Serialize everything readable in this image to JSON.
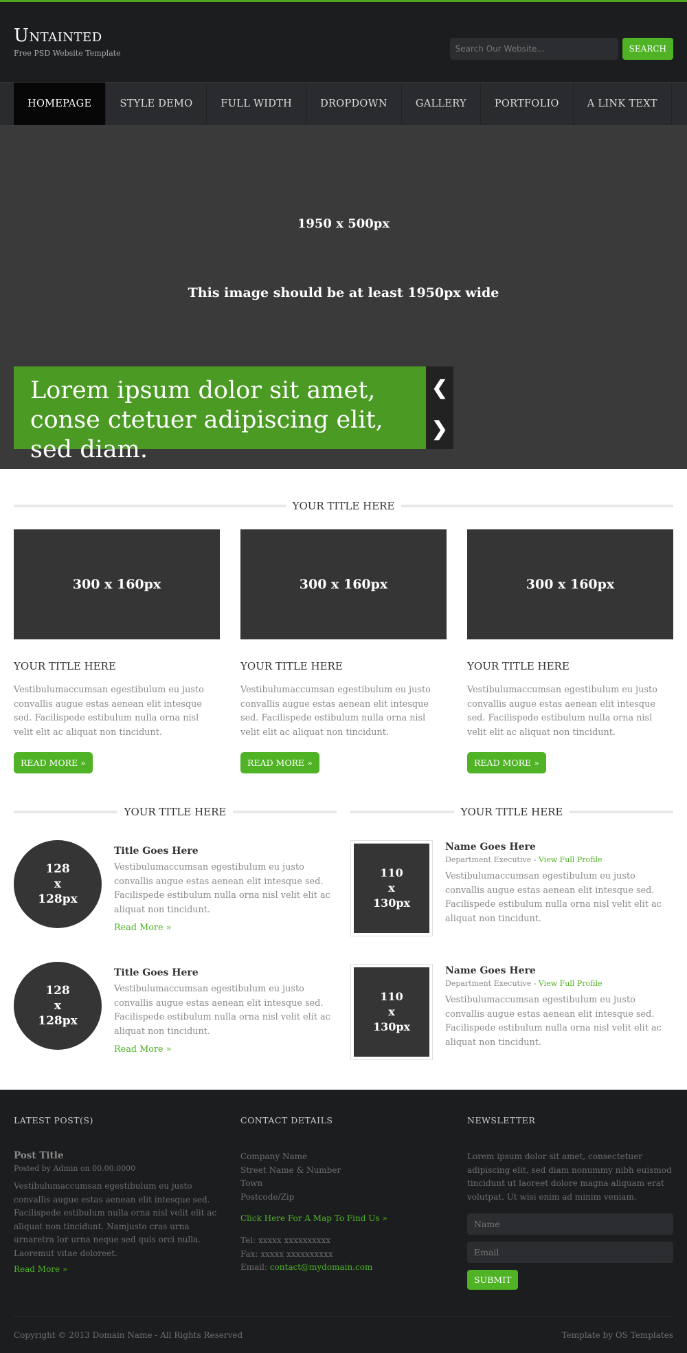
{
  "header": {
    "logo": "Untainted",
    "tagline": "Free PSD Website Template",
    "search_placeholder": "Search Our Website...",
    "search_button": "SEARCH"
  },
  "nav": {
    "items": [
      {
        "label": "HOMEPAGE",
        "active": true
      },
      {
        "label": "STYLE DEMO"
      },
      {
        "label": "FULL WIDTH"
      },
      {
        "label": "DROPDOWN"
      },
      {
        "label": "GALLERY"
      },
      {
        "label": "PORTFOLIO"
      },
      {
        "label": "A LINK TEXT"
      }
    ]
  },
  "hero": {
    "size_label": "1950 x 500px",
    "message": "This image should be at least 1950px wide",
    "caption": "Lorem ipsum dolor sit amet, conse ctetuer adipiscing elit, sed diam.",
    "prev_icon": "❮",
    "next_icon": "❯"
  },
  "features": {
    "section_title": "YOUR TITLE HERE",
    "items": [
      {
        "image_label": "300 x 160px",
        "title": "YOUR TITLE HERE",
        "text": "Vestibulumaccumsan egestibulum eu justo convallis augue estas aenean elit intesque sed. Facilispede estibulum nulla orna nisl velit elit ac aliquat non tincidunt.",
        "button": "READ MORE »"
      },
      {
        "image_label": "300 x 160px",
        "title": "YOUR TITLE HERE",
        "text": "Vestibulumaccumsan egestibulum eu justo convallis augue estas aenean elit intesque sed. Facilispede estibulum nulla orna nisl velit elit ac aliquat non tincidunt.",
        "button": "READ MORE »"
      },
      {
        "image_label": "300 x 160px",
        "title": "YOUR TITLE HERE",
        "text": "Vestibulumaccumsan egestibulum eu justo convallis augue estas aenean elit intesque sed. Facilispede estibulum nulla orna nisl velit elit ac aliquat non tincidunt.",
        "button": "READ MORE »"
      }
    ]
  },
  "posts": {
    "section_title": "YOUR TITLE HERE",
    "items": [
      {
        "image_lines": [
          "128",
          "x",
          "128px"
        ],
        "title": "Title Goes Here",
        "text": "Vestibulumaccumsan egestibulum eu justo convallis augue estas aenean elit intesque sed. Facilispede estibulum nulla orna nisl velit elit ac aliquat non tincidunt.",
        "link": "Read More »"
      },
      {
        "image_lines": [
          "128",
          "x",
          "128px"
        ],
        "title": "Title Goes Here",
        "text": "Vestibulumaccumsan egestibulum eu justo convallis augue estas aenean elit intesque sed. Facilispede estibulum nulla orna nisl velit elit ac aliquat non tincidunt.",
        "link": "Read More »"
      }
    ]
  },
  "team": {
    "section_title": "YOUR TITLE HERE",
    "items": [
      {
        "image_lines": [
          "110",
          "x",
          "130px"
        ],
        "name": "Name Goes Here",
        "dept": "Department Executive - ",
        "profile_link": "View Full Profile",
        "text": "Vestibulumaccumsan egestibulum eu justo convallis augue estas aenean elit intesque sed. Facilispede estibulum nulla orna nisl velit elit ac aliquat non tincidunt."
      },
      {
        "image_lines": [
          "110",
          "x",
          "130px"
        ],
        "name": "Name Goes Here",
        "dept": "Department Executive - ",
        "profile_link": "View Full Profile",
        "text": "Vestibulumaccumsan egestibulum eu justo convallis augue estas aenean elit intesque sed. Facilispede estibulum nulla orna nisl velit elit ac aliquat non tincidunt."
      }
    ]
  },
  "footer": {
    "latest": {
      "heading": "LATEST POST(S)",
      "post_title": "Post Title",
      "posted_by": "Posted by Admin on 00.00.0000",
      "text": "Vestibulumaccumsan egestibulum eu justo convallis augue estas aenean elit intesque sed. Facilispede estibulum nulla orna nisl velit elit ac aliquat non tincidunt. Namjusto cras urna urnaretra lor urna neque sed quis orci nulla. Laoremut vitae doloreet.",
      "link": "Read More »"
    },
    "contact": {
      "heading": "CONTACT DETAILS",
      "address": [
        "Company Name",
        "Street Name & Number",
        "Town",
        "Postcode/Zip"
      ],
      "map_link": "Click Here For A Map To Find Us »",
      "tel": "Tel: xxxxx xxxxxxxxxx",
      "fax": "Fax: xxxxx xxxxxxxxxx",
      "email_label": "Email: ",
      "email": "contact@mydomain.com"
    },
    "newsletter": {
      "heading": "NEWSLETTER",
      "text": "Lorem ipsum dolor sit amet, consectetuer adipiscing elit, sed diam nonummy nibh euismod tincidunt ut laoreet dolore magna aliquam erat volutpat. Ut wisi enim ad minim veniam.",
      "name_placeholder": "Name",
      "email_placeholder": "Email",
      "submit": "SUBMIT"
    },
    "copyright": "Copyright © 2013 Domain Name - All Rights Reserved",
    "credit": "Template by OS Templates"
  },
  "colors": {
    "accent": "#4fb325",
    "caption_bg": "#4a9a23",
    "header_bg": "#1c1d1f",
    "placeholder_bg": "#353535"
  }
}
